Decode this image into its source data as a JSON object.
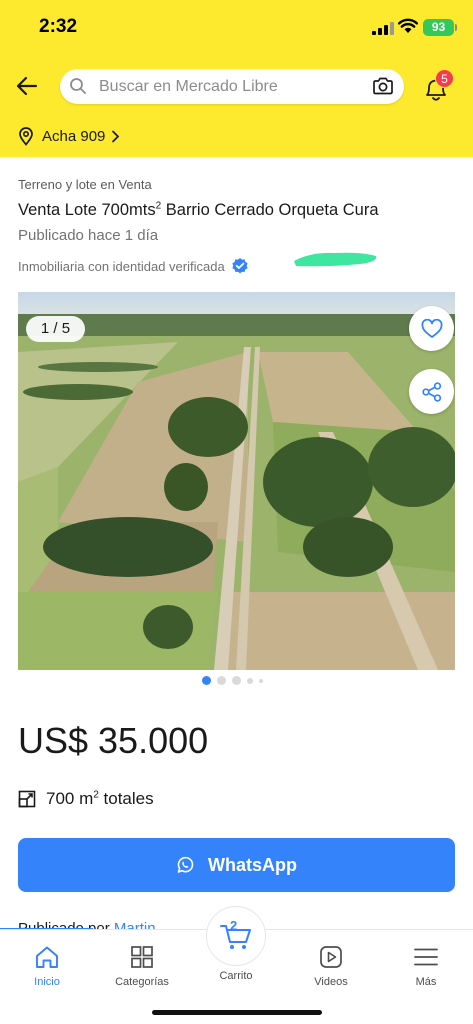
{
  "status_bar": {
    "time": "2:32",
    "battery": "93"
  },
  "header": {
    "search_placeholder": "Buscar en Mercado Libre",
    "notifications_count": "5",
    "location": "Acha 909"
  },
  "listing": {
    "category": "Terreno y lote en Venta",
    "title_prefix": "Venta Lote 700mts",
    "title_sup": "2",
    "title_suffix": " Barrio Cerrado Orqueta Cura",
    "published": "Publicado hace 1 día",
    "seller": "Inmobiliaria con identidad verificada",
    "photo_counter": "1 / 5",
    "price": "US$ 35.000",
    "area_prefix": "700 m",
    "area_sup": "2",
    "area_suffix": " totales",
    "whatsapp_label": "WhatsApp",
    "peek_prefix": "Publicado por ",
    "peek_link": "Martin"
  },
  "bottom_nav": {
    "items": [
      {
        "label": "Inicio",
        "icon": "home-icon",
        "active": true
      },
      {
        "label": "Categorías",
        "icon": "grid-icon",
        "active": false
      },
      {
        "label": "Carrito",
        "icon": "cart-icon",
        "active": false
      },
      {
        "label": "Videos",
        "icon": "play-icon",
        "active": false
      },
      {
        "label": "Más",
        "icon": "menu-icon",
        "active": false
      }
    ],
    "cart_count": "2"
  },
  "colors": {
    "brand_yellow": "#fde92d",
    "accent_blue": "#3483fa",
    "badge_red": "#f23d4f",
    "redaction_green": "#3ee6a0"
  }
}
